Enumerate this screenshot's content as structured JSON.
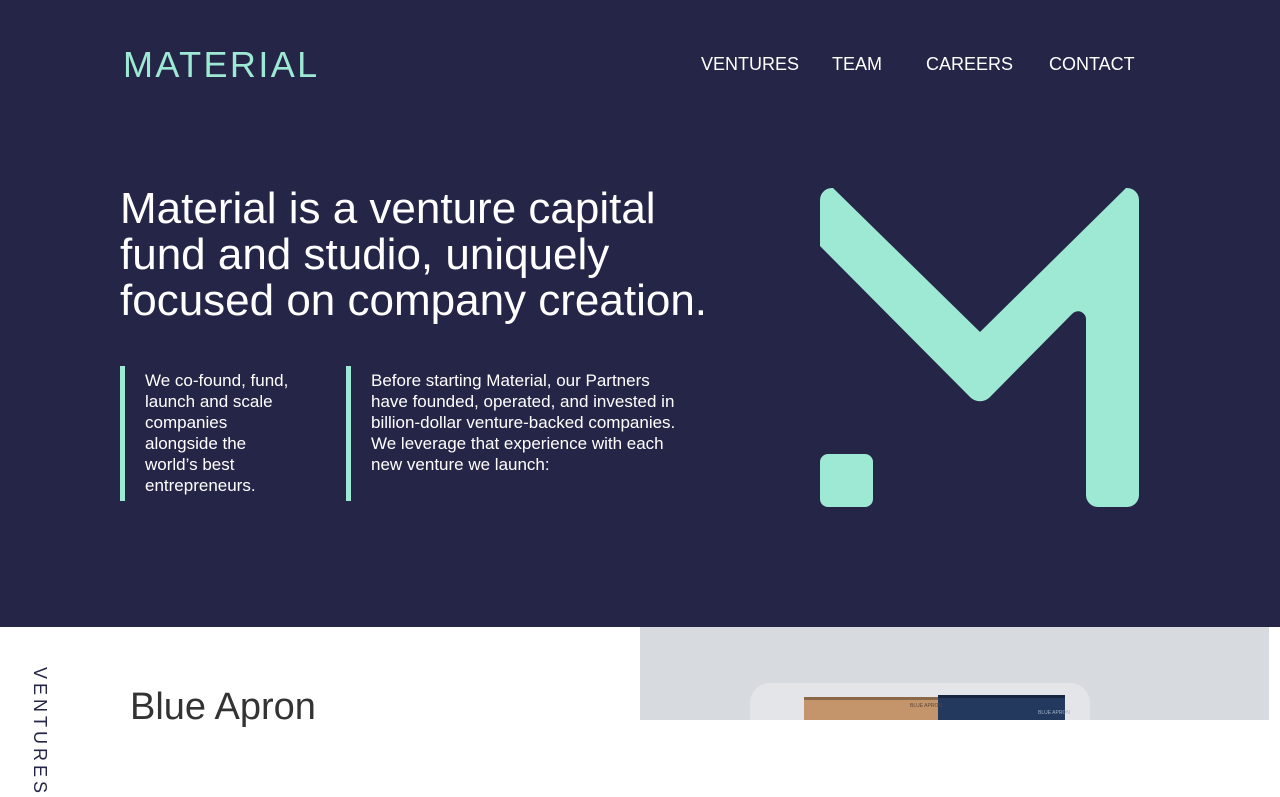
{
  "brand": {
    "logo_text": "MATERIAL",
    "accent_color": "#9de9d4",
    "background_color": "#242547"
  },
  "nav": {
    "items": [
      {
        "label": "VENTURES"
      },
      {
        "label": "TEAM"
      },
      {
        "label": "CAREERS"
      },
      {
        "label": "CONTACT"
      }
    ]
  },
  "hero": {
    "headline_lines": [
      "Material is a venture capital",
      "fund and studio, uniquely",
      "focused on company creation."
    ],
    "columns": [
      {
        "text": "We co-found, fund, launch and scale companies alongside the world’s best entrepreneurs."
      },
      {
        "text": "Before starting Material, our Partners have founded, operated, and invested in billion-dollar venture-backed companies. We leverage that experience with each new venture we launch:"
      }
    ],
    "mark_icon": "material-m-logo-icon"
  },
  "ventures_section": {
    "side_label": "VENTURES",
    "company_name": "Blue Apron",
    "box_printed_text": "BLUE APRON"
  }
}
